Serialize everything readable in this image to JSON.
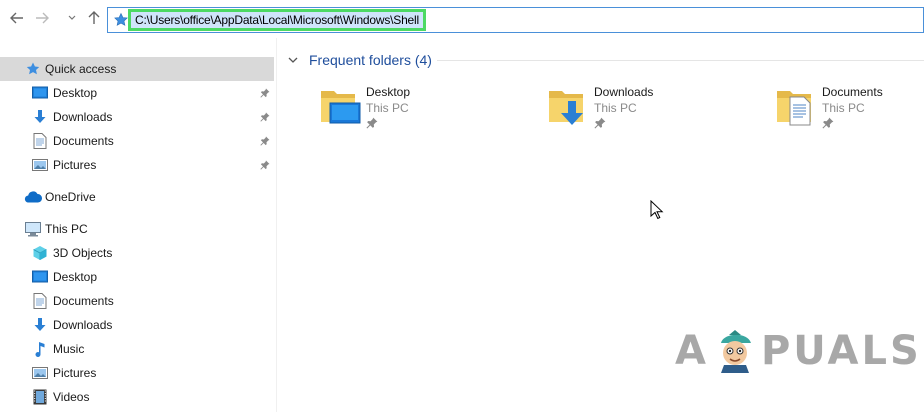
{
  "address": {
    "path": "C:\\Users\\office\\AppData\\Local\\Microsoft\\Windows\\Shell"
  },
  "sidebar": {
    "quick_access": "Quick access",
    "quick_items": [
      {
        "label": "Desktop"
      },
      {
        "label": "Downloads"
      },
      {
        "label": "Documents"
      },
      {
        "label": "Pictures"
      }
    ],
    "onedrive": "OneDrive",
    "this_pc": "This PC",
    "pc_items": [
      {
        "label": "3D Objects"
      },
      {
        "label": "Desktop"
      },
      {
        "label": "Documents"
      },
      {
        "label": "Downloads"
      },
      {
        "label": "Music"
      },
      {
        "label": "Pictures"
      },
      {
        "label": "Videos"
      }
    ]
  },
  "main": {
    "group_title": "Frequent folders (4)",
    "tiles": [
      {
        "name": "Desktop",
        "location": "This PC"
      },
      {
        "name": "Downloads",
        "location": "This PC"
      },
      {
        "name": "Documents",
        "location": "This PC"
      }
    ]
  },
  "watermark": {
    "left": "A",
    "right": "PUALS"
  },
  "colors": {
    "accent": "#4a90d9",
    "highlight_border": "#4cd964",
    "selected_bg": "#d9d9d9",
    "group_title": "#1f4e9c"
  }
}
